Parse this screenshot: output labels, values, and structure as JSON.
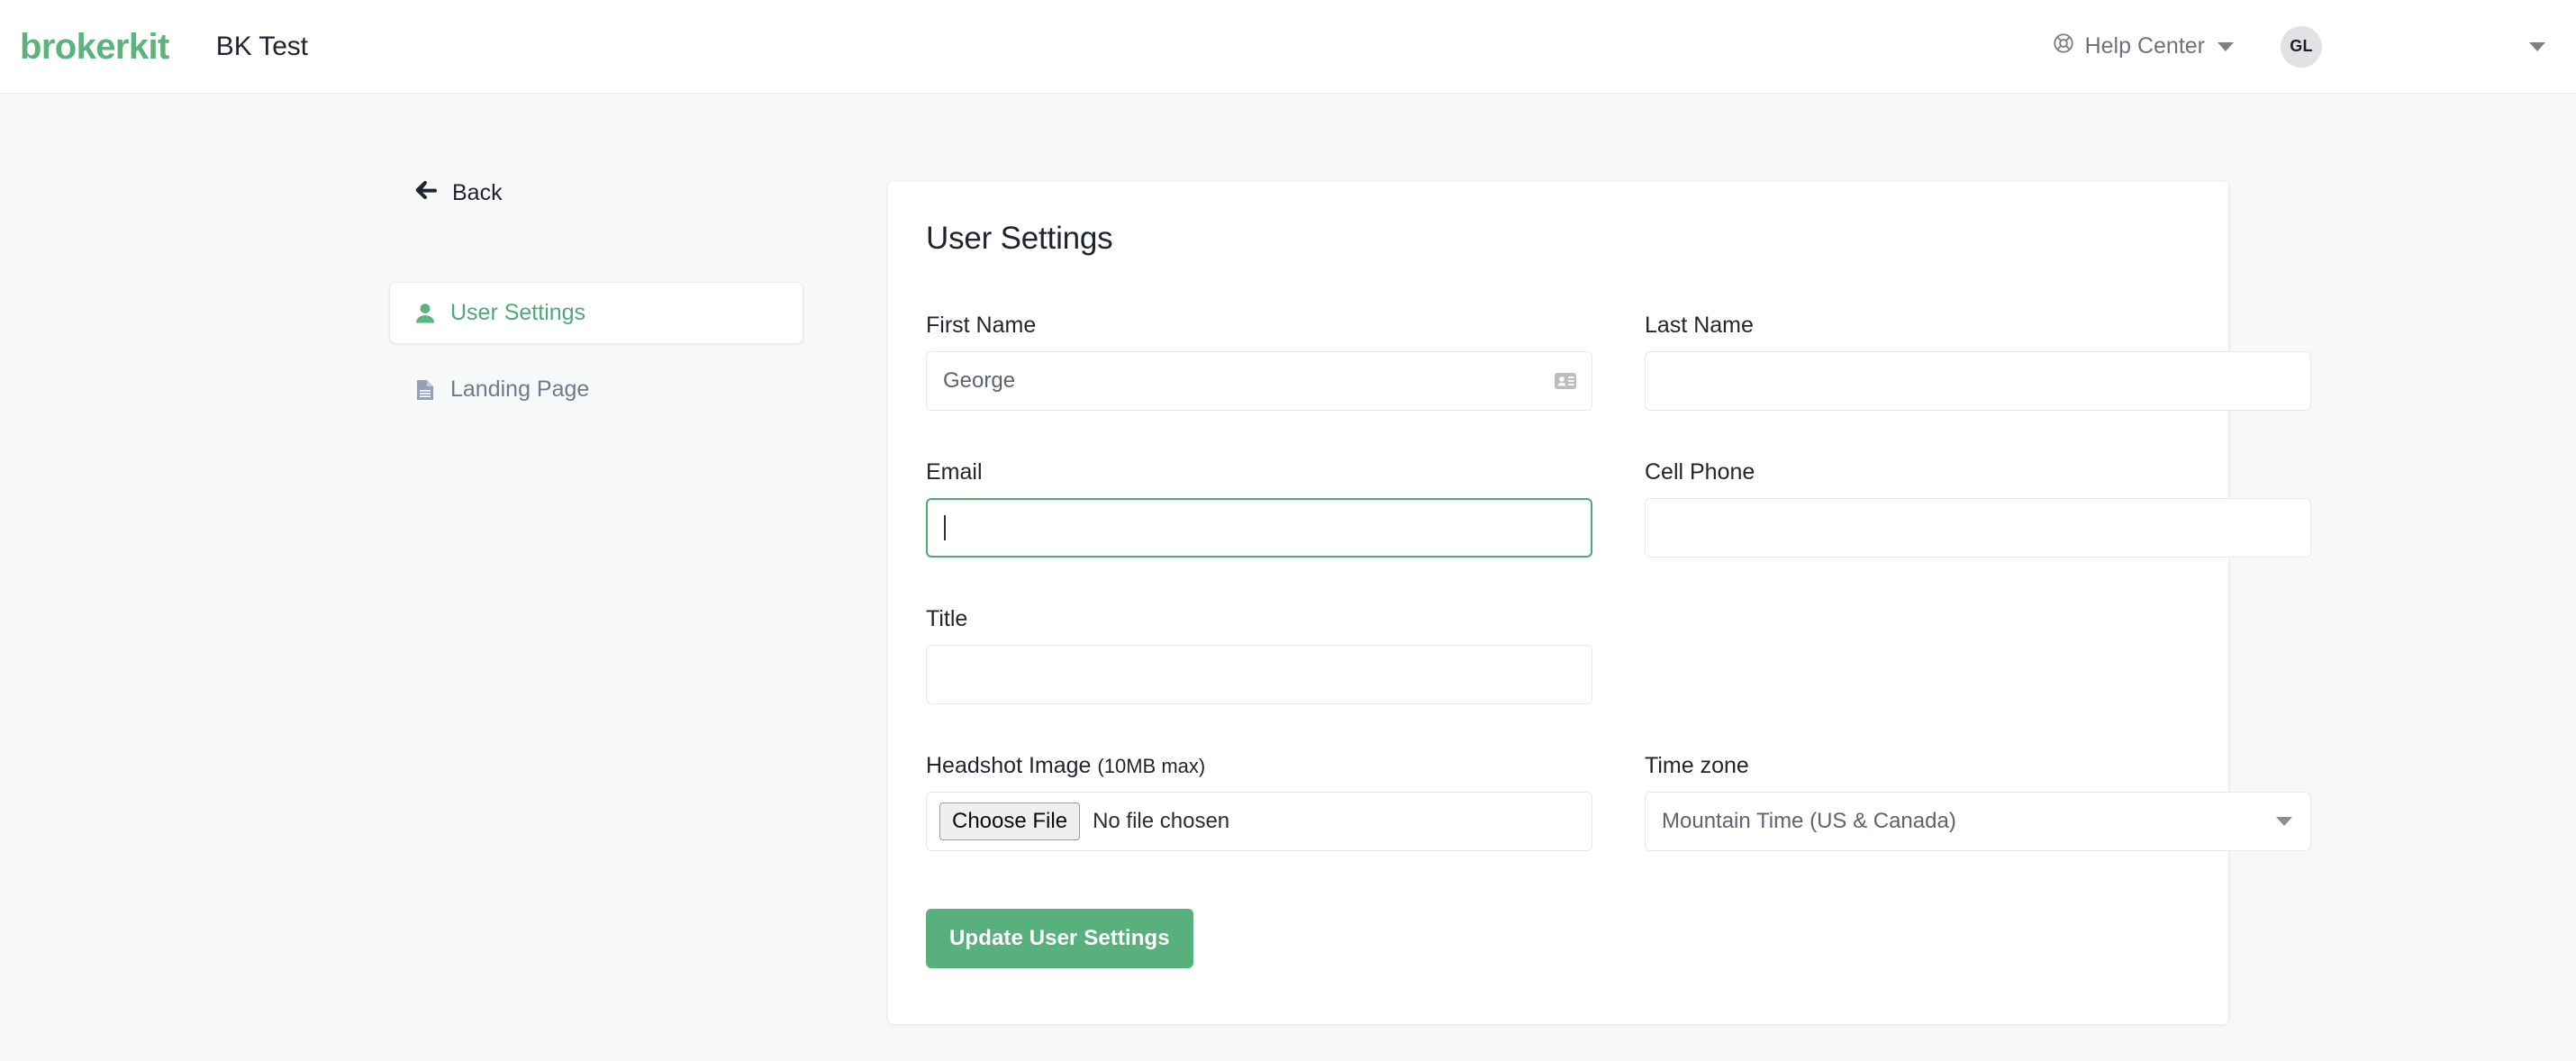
{
  "header": {
    "brand": "brokerkit",
    "workspace": "BK Test",
    "help_center": "Help Center",
    "avatar_initials": "GL",
    "brand_color": "#5cb37e"
  },
  "sidebar": {
    "back_label": "Back",
    "items": [
      {
        "label": "User Settings",
        "icon": "user-icon",
        "active": true
      },
      {
        "label": "Landing Page",
        "icon": "document-icon",
        "active": false
      }
    ]
  },
  "main": {
    "card_title": "User Settings",
    "fields": {
      "first_name": {
        "label": "First Name",
        "value": "George",
        "placeholder": ""
      },
      "last_name": {
        "label": "Last Name",
        "value": "",
        "placeholder": ""
      },
      "email": {
        "label": "Email",
        "value": "",
        "placeholder": "",
        "focused": true
      },
      "cell_phone": {
        "label": "Cell Phone",
        "value": "",
        "placeholder": ""
      },
      "title": {
        "label": "Title",
        "value": "",
        "placeholder": ""
      },
      "headshot": {
        "label": "Headshot Image",
        "label_hint": "(10MB max)",
        "button_label": "Choose File",
        "status": "No file chosen"
      },
      "time_zone": {
        "label": "Time zone",
        "value": "Mountain Time (US & Canada)"
      }
    },
    "submit_label": "Update User Settings",
    "accent_color": "#58b07d"
  }
}
